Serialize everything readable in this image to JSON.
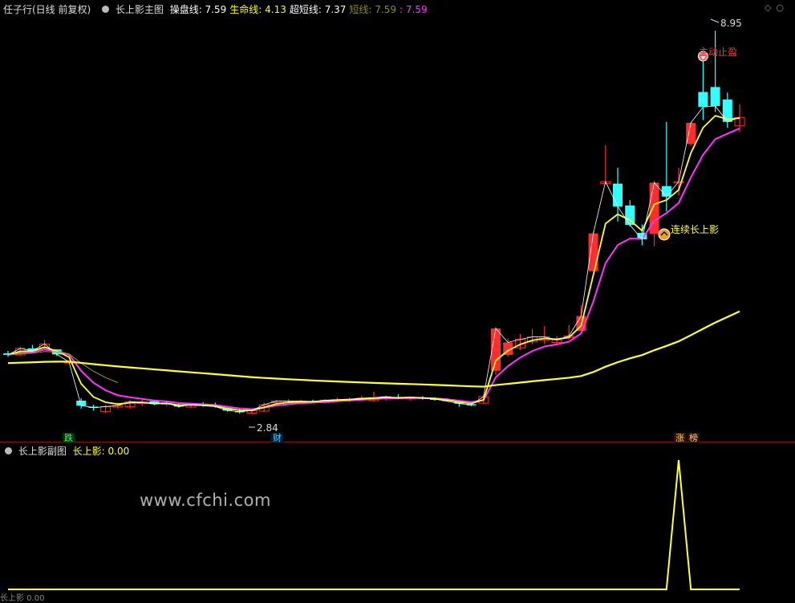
{
  "stock_title": "任子行(日线 前复权)",
  "main_indicator": {
    "name": "长上影主图",
    "items": [
      {
        "label": "操盘线: 7.59",
        "color": "#ffffff"
      },
      {
        "label": "生命线: 4.13",
        "color": "#ffff00"
      },
      {
        "label": "超短线: 7.37",
        "color": "#ffffff"
      },
      {
        "label": "短线: 7.59",
        "color": "#8a8a20"
      },
      {
        "label": ": 7.59",
        "color": "#ff33ff"
      }
    ]
  },
  "sub_indicator": {
    "name": "长上影副图",
    "value_label": "长上影: 0.00"
  },
  "annotations": {
    "high_price": "8.95",
    "low_price": "2.84",
    "take_profit": "主动止盈",
    "signal": "连续长上影",
    "tag_fall": "跌",
    "tag_cai": "财",
    "tag_zhang": "涨",
    "tag_bang": "榜"
  },
  "watermark": "www.cfchi.com",
  "bottom_strip": "长上影 0.00",
  "colors": {
    "up": "#ff2d2d",
    "down": "#33ffff",
    "yellow": "#ffff33",
    "magenta": "#ff33ff",
    "white": "#ffffff",
    "olive": "#9a9a2a"
  },
  "candles": [
    [
      2.95,
      3.0,
      2.88,
      2.92
    ],
    [
      2.92,
      3.08,
      2.9,
      3.05
    ],
    [
      3.05,
      3.12,
      2.98,
      3.0
    ],
    [
      3.06,
      3.22,
      3.02,
      3.14
    ],
    [
      3.03,
      3.03,
      2.9,
      2.93
    ],
    [
      2.76,
      2.8,
      2.76,
      2.78
    ],
    [
      2.0,
      2.05,
      1.84,
      1.9
    ],
    [
      1.88,
      1.92,
      1.8,
      1.86
    ],
    [
      1.78,
      1.92,
      1.75,
      1.88
    ],
    [
      1.87,
      1.96,
      1.84,
      1.9
    ],
    [
      1.88,
      2.02,
      1.84,
      1.98
    ],
    [
      1.96,
      2.02,
      1.9,
      1.97
    ],
    [
      1.99,
      2.02,
      1.91,
      1.93
    ],
    [
      1.93,
      1.98,
      1.89,
      1.95
    ],
    [
      1.92,
      1.96,
      1.86,
      1.88
    ],
    [
      1.87,
      1.94,
      1.85,
      1.92
    ],
    [
      1.92,
      1.97,
      1.88,
      1.9
    ],
    [
      1.91,
      1.96,
      1.86,
      1.88
    ],
    [
      1.85,
      1.88,
      1.78,
      1.8
    ],
    [
      1.79,
      1.84,
      1.74,
      1.78
    ],
    [
      1.75,
      1.82,
      1.72,
      1.8
    ],
    [
      1.79,
      1.96,
      1.77,
      1.92
    ],
    [
      1.96,
      2.01,
      1.92,
      1.99
    ],
    [
      1.97,
      2.03,
      1.94,
      1.99
    ],
    [
      1.98,
      2.02,
      1.94,
      1.99
    ],
    [
      1.99,
      2.02,
      1.95,
      1.98
    ],
    [
      1.96,
      2.03,
      1.94,
      2.01
    ],
    [
      2.0,
      2.06,
      1.97,
      2.02
    ],
    [
      2.01,
      2.06,
      1.97,
      2.03
    ],
    [
      2.02,
      2.1,
      1.99,
      2.05
    ],
    [
      2.0,
      2.18,
      1.98,
      2.06
    ],
    [
      2.04,
      2.1,
      2.0,
      2.08
    ],
    [
      2.06,
      2.13,
      2.03,
      2.05
    ],
    [
      2.04,
      2.08,
      2.0,
      2.07
    ],
    [
      2.06,
      2.09,
      2.02,
      2.05
    ],
    [
      2.04,
      2.07,
      2.0,
      2.03
    ],
    [
      2.02,
      2.05,
      1.98,
      1.99
    ],
    [
      1.98,
      2.0,
      1.88,
      1.94
    ],
    [
      1.93,
      1.96,
      1.89,
      1.92
    ],
    [
      1.95,
      2.12,
      1.94,
      2.08
    ],
    [
      2.6,
      3.48,
      2.52,
      3.45
    ],
    [
      2.92,
      3.25,
      2.88,
      3.17
    ],
    [
      3.06,
      3.34,
      3.02,
      3.23
    ],
    [
      3.18,
      3.44,
      3.13,
      3.28
    ],
    [
      3.21,
      3.5,
      3.14,
      3.28
    ],
    [
      3.17,
      3.3,
      3.1,
      3.22
    ],
    [
      3.27,
      3.52,
      3.23,
      3.3
    ],
    [
      3.4,
      3.92,
      3.4,
      3.7
    ],
    [
      4.6,
      5.4,
      4.6,
      5.36
    ],
    [
      6.36,
      7.13,
      6.36,
      6.4
    ],
    [
      6.36,
      6.68,
      5.6,
      5.9
    ],
    [
      5.92,
      6.03,
      5.5,
      5.53
    ],
    [
      5.37,
      5.54,
      5.12,
      5.24
    ],
    [
      5.35,
      6.42,
      5.1,
      6.38
    ],
    [
      6.31,
      7.6,
      5.8,
      6.1
    ],
    [
      6.38,
      6.68,
      6.12,
      6.4
    ],
    [
      7.16,
      7.6,
      7.12,
      7.58
    ],
    [
      8.2,
      8.96,
      7.64,
      7.9
    ],
    [
      8.3,
      9.43,
      7.8,
      7.92
    ],
    [
      8.05,
      8.19,
      7.48,
      7.6
    ],
    [
      7.52,
      7.95,
      7.4,
      7.69
    ]
  ],
  "sub_signal": [
    0,
    0,
    0,
    0,
    0,
    0,
    0,
    0,
    0,
    0,
    0,
    0,
    0,
    0,
    0,
    0,
    0,
    0,
    0,
    0,
    0,
    0,
    0,
    0,
    0,
    0,
    0,
    0,
    0,
    0,
    0,
    0,
    0,
    0,
    0,
    0,
    0,
    0,
    0,
    0,
    0,
    0,
    0,
    0,
    0,
    0,
    0,
    0,
    0,
    0,
    0,
    0,
    0,
    0,
    0,
    1,
    0,
    0,
    0,
    0,
    0
  ]
}
